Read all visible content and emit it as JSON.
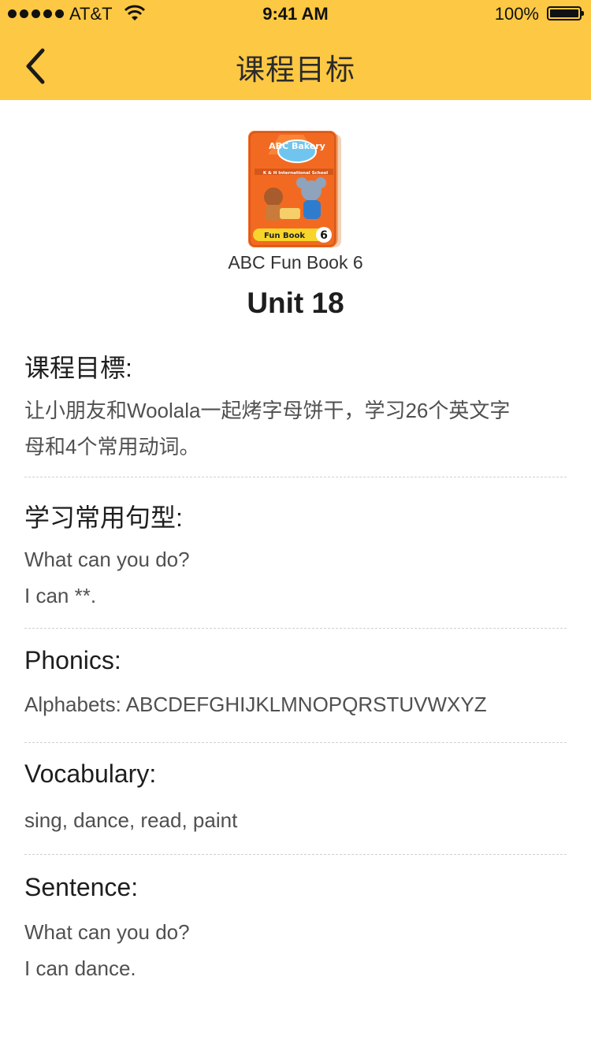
{
  "status_bar": {
    "carrier": "AT&T",
    "time": "9:41 AM",
    "battery": "100%"
  },
  "nav": {
    "title": "课程目标",
    "back_icon": "chevron-left-icon"
  },
  "book": {
    "cover_icon": "book-cover-image",
    "cover_title": "ABC Bakery",
    "cover_school": "K & H International School",
    "cover_label": "Fun Book",
    "cover_number": "6",
    "name": "ABC Fun Book 6",
    "unit": "Unit 18"
  },
  "sections": {
    "goal": {
      "title": "课程目標:",
      "lines": [
        "让小朋友和Woolala一起烤字母饼干，学习26个英文字",
        "母和4个常用动词。"
      ]
    },
    "patterns": {
      "title": "学习常用句型:",
      "lines": [
        "What can you do?",
        "I can **."
      ]
    },
    "phonics": {
      "title": "Phonics:",
      "lines": [
        "Alphabets: ABCDEFGHIJKLMNOPQRSTUVWXYZ"
      ]
    },
    "vocabulary": {
      "title": "Vocabulary:",
      "lines": [
        "sing, dance, read, paint"
      ]
    },
    "sentence": {
      "title": "Sentence:",
      "lines": [
        "What can you do?",
        "I can dance."
      ]
    }
  },
  "colors": {
    "header": "#fdc843",
    "cover_orange": "#f26a21"
  }
}
